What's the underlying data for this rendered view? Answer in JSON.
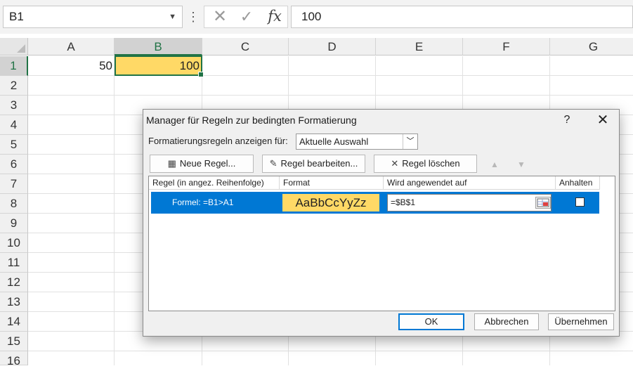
{
  "formula_bar": {
    "name_box": "B1",
    "formula": "100",
    "fx_label": "fx",
    "icons": {
      "dropdown": "chevron-down-icon",
      "more": "vertical-dots-icon",
      "cancel": "x-icon",
      "enter": "check-icon"
    }
  },
  "columns": [
    "A",
    "B",
    "C",
    "D",
    "E",
    "F",
    "G"
  ],
  "rows": [
    "1",
    "2",
    "3",
    "4",
    "5",
    "6",
    "7",
    "8",
    "9",
    "10",
    "11",
    "12",
    "13",
    "14",
    "15",
    "16"
  ],
  "cells": {
    "A1": "50",
    "B1": "100"
  },
  "selection": {
    "cell": "B1",
    "column": "B",
    "row": "1",
    "fill_color": "#ffd966",
    "accent_color": "#217346"
  },
  "dialog": {
    "title": "Manager für Regeln zur bedingten Formatierung",
    "help": "?",
    "close": "✕",
    "show_rules_label": "Formatierungsregeln anzeigen für:",
    "show_rules_value": "Aktuelle Auswahl",
    "buttons": {
      "new_rule": "Neue Regel...",
      "edit_rule": "Regel bearbeiten...",
      "delete_rule": "Regel löschen",
      "ok": "OK",
      "cancel": "Abbrechen",
      "apply": "Übernehmen"
    },
    "columns": {
      "rule": "Regel (in angez. Reihenfolge)",
      "format": "Format",
      "applies_to": "Wird angewendet auf",
      "stop_if_true": "Anhalten"
    },
    "rules": [
      {
        "rule": "Formel: =B1>A1",
        "format_preview": "AaBbCcYyZz",
        "applies_to": "=$B$1",
        "stop_if_true": false
      }
    ],
    "selected_row_color": "#0078d4"
  }
}
